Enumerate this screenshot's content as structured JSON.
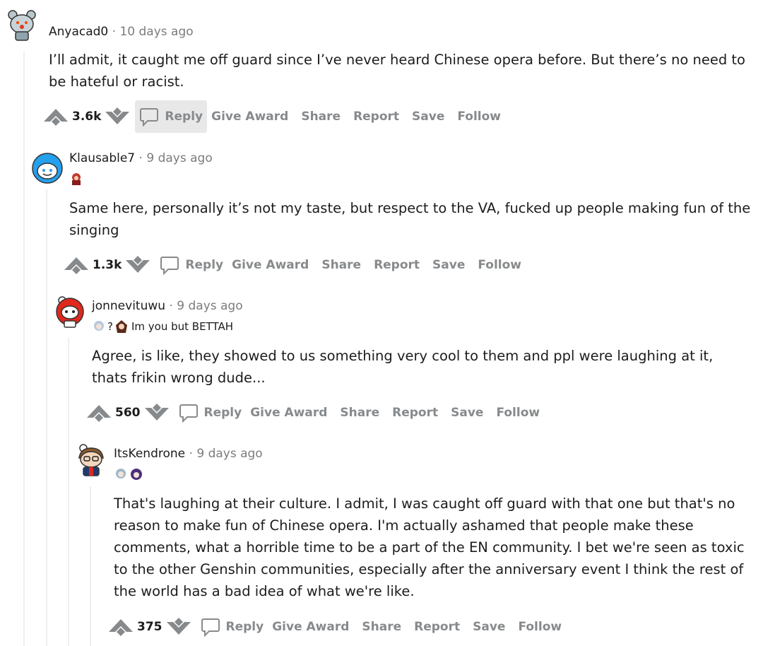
{
  "actions": {
    "reply": "Reply",
    "give_award": "Give Award",
    "share": "Share",
    "report": "Report",
    "save": "Save",
    "follow": "Follow"
  },
  "separator": "·",
  "comments": [
    {
      "author": "Anyacad0",
      "time": "10 days ago",
      "flair_text": "",
      "body": "I’ll admit, it caught me off guard since I’ve never heard Chinese opera before. But there’s no need to be hateful or racist.",
      "score": "3.6k"
    },
    {
      "author": "Klausable7",
      "time": "9 days ago",
      "flair_text": "",
      "body": "Same here, personally it’s not my taste, but respect to the VA, fucked up people making fun of the singing",
      "score": "1.3k"
    },
    {
      "author": "jonnevituwu",
      "time": "9 days ago",
      "flair_text": "Im you but BETTAH",
      "flair_mark": "?",
      "body": "Agree, is like, they showed to us something very cool to them and ppl were laughing at it, thats frikin wrong dude...",
      "score": "560"
    },
    {
      "author": "ItsKendrone",
      "time": "9 days ago",
      "flair_text": "",
      "body": "That's laughing at their culture. I admit, I was caught off guard with that one but that's no reason to make fun of Chinese opera. I'm actually ashamed that people make these comments, what a horrible time to be a part of the EN community. I bet we're seen as toxic to the other Genshin communities, especially after the anniversary event I think the rest of the world has a bad idea of what we're like.",
      "score": "375"
    }
  ]
}
